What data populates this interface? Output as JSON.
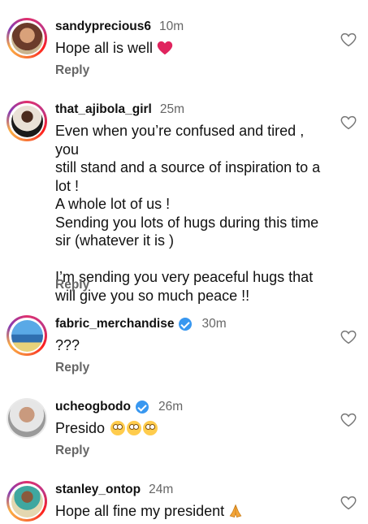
{
  "comments": [
    {
      "username": "sandyprecious6",
      "time": "10m",
      "text": "Hope all is well",
      "text_emoji": "red-heart",
      "verified": false,
      "reply_label": "Reply"
    },
    {
      "username": "that_ajibola_girl",
      "time": "25m",
      "text": "Even when you’re confused and tired , you\nstill stand and a source of inspiration to a\nlot !\nA whole lot of us !\nSending you lots of hugs during this time\nsir (whatever it is )\n\nI’m sending you very peaceful hugs that\nwill give you so much peace !!",
      "verified": false,
      "reply_label": "Reply"
    },
    {
      "username": "fabric_merchandise",
      "time": "30m",
      "text": "???",
      "verified": true,
      "reply_label": "Reply"
    },
    {
      "username": "ucheogbodo",
      "time": "26m",
      "text": "Presido",
      "text_emoji": "face-with-rolling-eyes x3",
      "verified": true,
      "reply_label": "Reply"
    },
    {
      "username": "stanley_ontop",
      "time": "24m",
      "text": "Hope all fine my president",
      "text_emoji": "folded-hands",
      "verified": false
    }
  ],
  "colors": {
    "username": "#111111",
    "secondary": "#666666",
    "verified": "#3897f0",
    "story_ring": "#e1306c"
  }
}
